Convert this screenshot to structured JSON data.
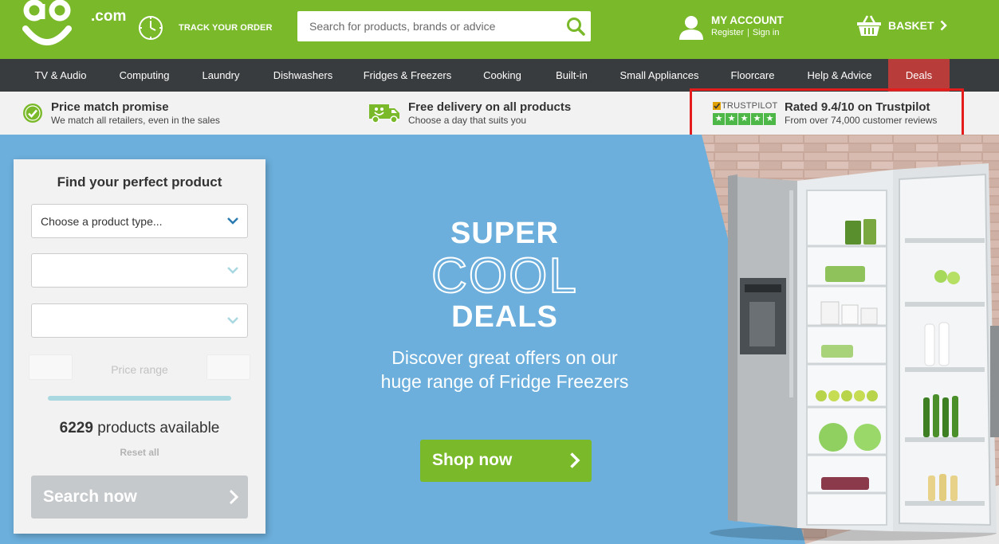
{
  "colors": {
    "brand_green": "#7ab929",
    "nav_dark": "#393c3e",
    "deals_red": "#b73c3a",
    "hero_blue": "#6cafdc",
    "trustpilot_green": "#4db848",
    "highlight_red": "#e41c1c"
  },
  "header": {
    "logo_text": "ao",
    "logo_domain": ".com",
    "track_order": "TRACK YOUR ORDER",
    "search_placeholder": "Search for products, brands or advice",
    "account_title": "MY ACCOUNT",
    "account_register": "Register",
    "account_sign_in": "Sign in",
    "basket_label": "BASKET"
  },
  "nav": {
    "items": [
      {
        "label": "TV & Audio"
      },
      {
        "label": "Computing"
      },
      {
        "label": "Laundry"
      },
      {
        "label": "Dishwashers"
      },
      {
        "label": "Fridges & Freezers"
      },
      {
        "label": "Cooking"
      },
      {
        "label": "Built-in"
      },
      {
        "label": "Small Appliances"
      },
      {
        "label": "Floorcare"
      },
      {
        "label": "Help & Advice"
      },
      {
        "label": "Deals"
      }
    ]
  },
  "usp": {
    "price_match_title": "Price match promise",
    "price_match_sub": "We match all retailers, even in the sales",
    "delivery_title": "Free delivery on all products",
    "delivery_sub": "Choose a day that suits you",
    "trustpilot_brand": "TRUSTPILOT",
    "trustpilot_title": "Rated 9.4/10 on Trustpilot",
    "trustpilot_sub": "From over 74,000 customer reviews",
    "trustpilot_stars": 5
  },
  "hero": {
    "super": "SUPER",
    "cool": "COOL",
    "deals": "DEALS",
    "line1": "Discover great offers on our",
    "line2": "huge range of Fridge Freezers",
    "cta": "Shop now"
  },
  "finder": {
    "title": "Find your perfect product",
    "product_type_value": "Choose a product type...",
    "select2_value": "",
    "select3_value": "",
    "price_range_label": "Price range",
    "count": "6229",
    "count_suffix": "products available",
    "reset": "Reset all",
    "search_button": "Search now"
  }
}
